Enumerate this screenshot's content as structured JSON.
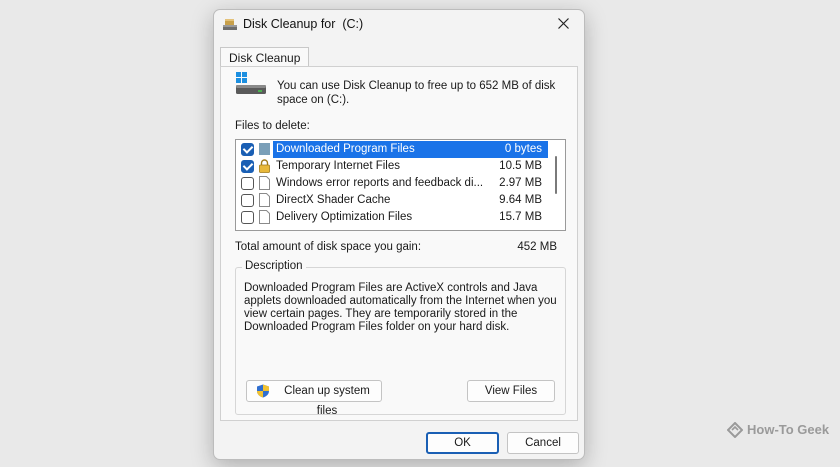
{
  "window": {
    "title": "Disk Cleanup for  (C:)"
  },
  "tabs": [
    {
      "label": "Disk Cleanup"
    }
  ],
  "intro_text": "You can use Disk Cleanup to free up to 652 MB of disk\nspace on  (C:).",
  "files_label": "Files to delete:",
  "files": [
    {
      "name": "Downloaded Program Files",
      "size": "0 bytes",
      "checked": true,
      "selected": true,
      "icon": "folder-icon"
    },
    {
      "name": "Temporary Internet Files",
      "size": "10.5 MB",
      "checked": true,
      "selected": false,
      "icon": "lock-icon"
    },
    {
      "name": "Windows error reports and feedback di...",
      "size": "2.97 MB",
      "checked": false,
      "selected": false,
      "icon": "file-icon"
    },
    {
      "name": "DirectX Shader Cache",
      "size": "9.64 MB",
      "checked": false,
      "selected": false,
      "icon": "file-icon"
    },
    {
      "name": "Delivery Optimization Files",
      "size": "15.7 MB",
      "checked": false,
      "selected": false,
      "icon": "file-icon"
    }
  ],
  "total": {
    "label": "Total amount of disk space you gain:",
    "value": "452 MB"
  },
  "description": {
    "legend": "Description",
    "text": "Downloaded Program Files are ActiveX controls and Java applets downloaded automatically from the Internet when you view certain pages. They are temporarily stored in the Downloaded Program Files folder on your hard disk."
  },
  "buttons": {
    "cleanup_system": "Clean up system files",
    "view_files": "View Files",
    "ok": "OK",
    "cancel": "Cancel"
  },
  "watermark": "How-To Geek",
  "colors": {
    "accent": "#1a73e8",
    "checkbox": "#1a5fb4"
  }
}
